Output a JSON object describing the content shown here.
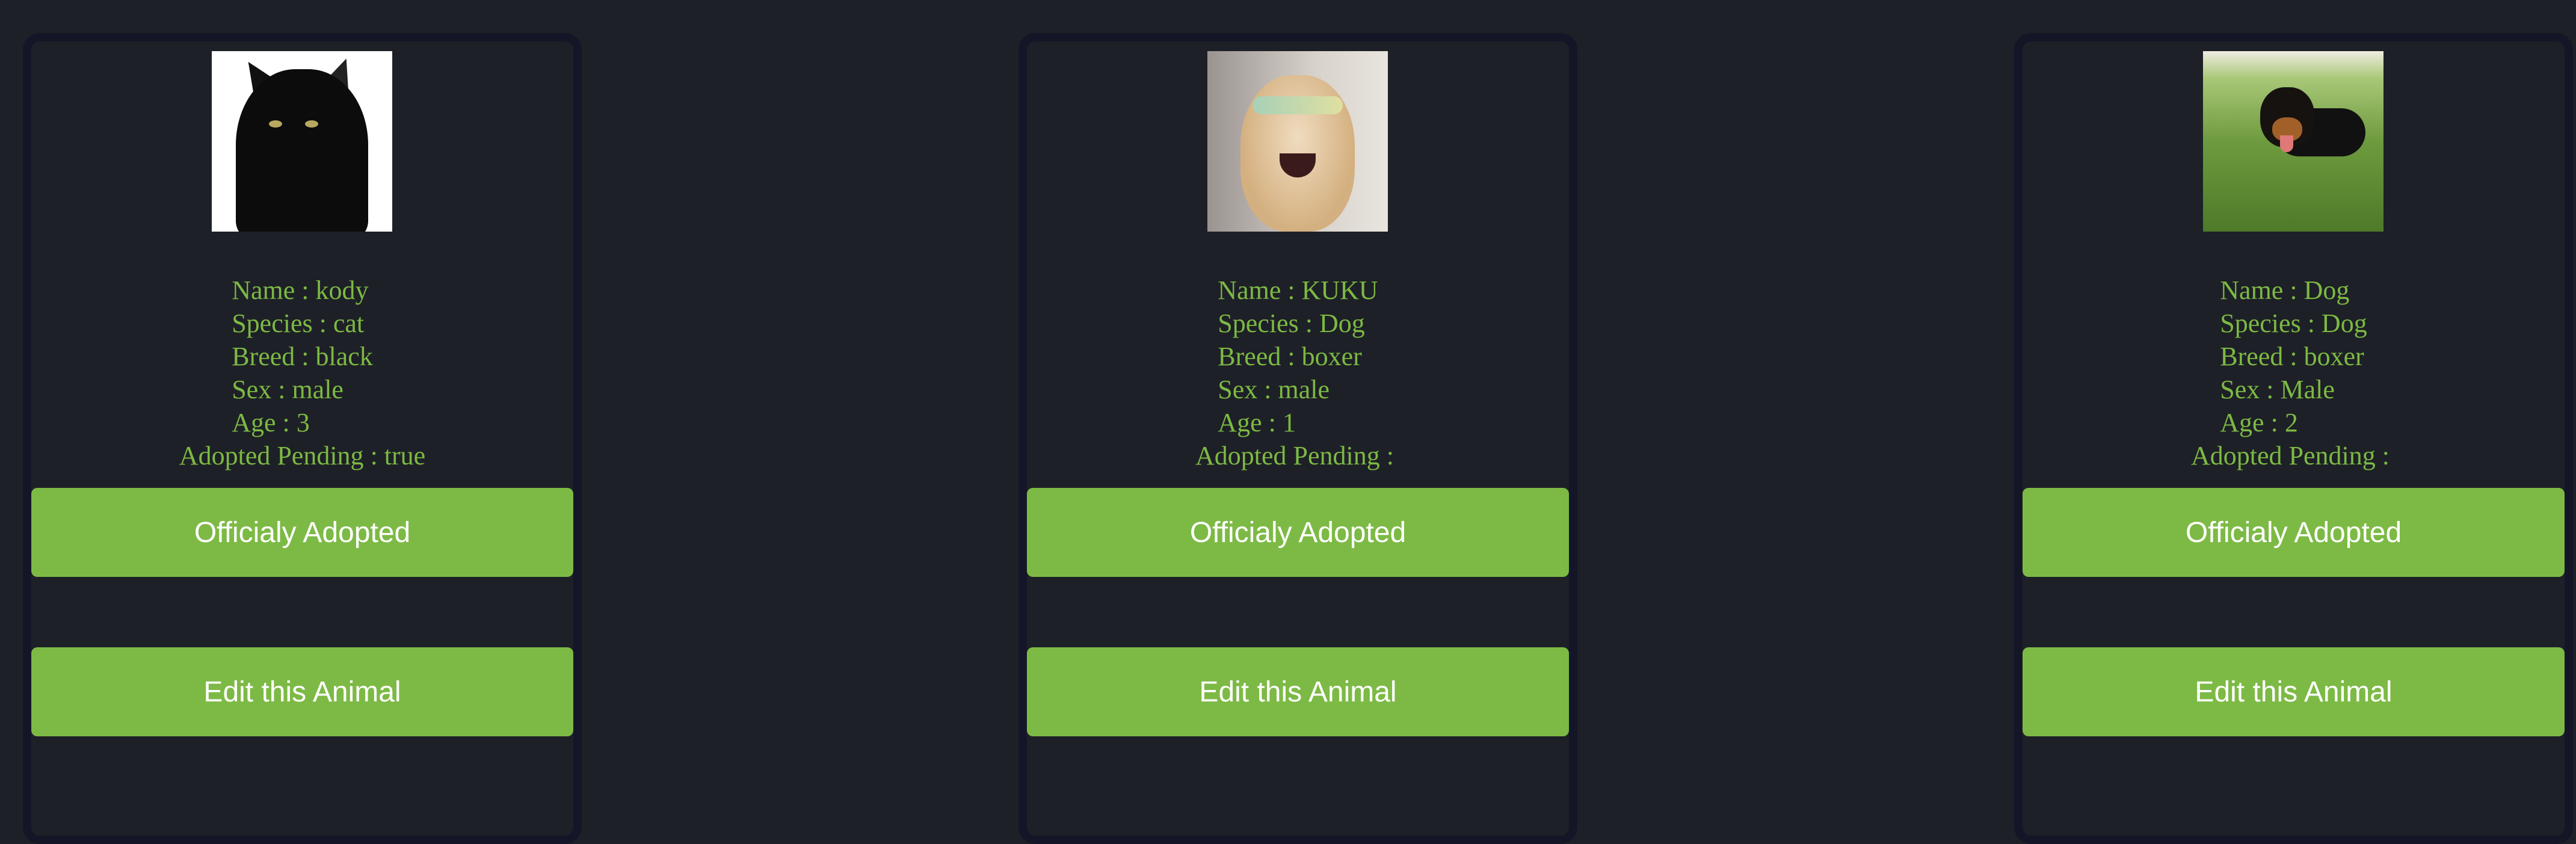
{
  "colors": {
    "text": "#7cb943",
    "button": "#7dba45",
    "background": "#1e2027",
    "border": "#141628"
  },
  "labels": {
    "name": "Name",
    "species": "Species",
    "breed": "Breed",
    "sex": "Sex",
    "age": "Age",
    "adopted_pending": "Adopted Pending"
  },
  "animals": [
    {
      "name": "kody",
      "species": "cat",
      "breed": "black",
      "sex": "male",
      "age": "3",
      "adopted_pending": "true",
      "photo": "black-cat-photo",
      "adopt_button": "Officialy Adopted",
      "edit_button": "Edit this Animal"
    },
    {
      "name": "KUKU",
      "species": "Dog",
      "breed": "boxer",
      "sex": "male",
      "age": "1",
      "adopted_pending": "",
      "photo": "golden-retriever-sunglasses-photo",
      "adopt_button": "Officialy Adopted",
      "edit_button": "Edit this Animal"
    },
    {
      "name": "Dog",
      "species": "Dog",
      "breed": "boxer",
      "sex": "Male",
      "age": "2",
      "adopted_pending": "",
      "photo": "rottweiler-puppy-grass-photo",
      "adopt_button": "Officialy Adopted",
      "edit_button": "Edit this Animal"
    }
  ]
}
